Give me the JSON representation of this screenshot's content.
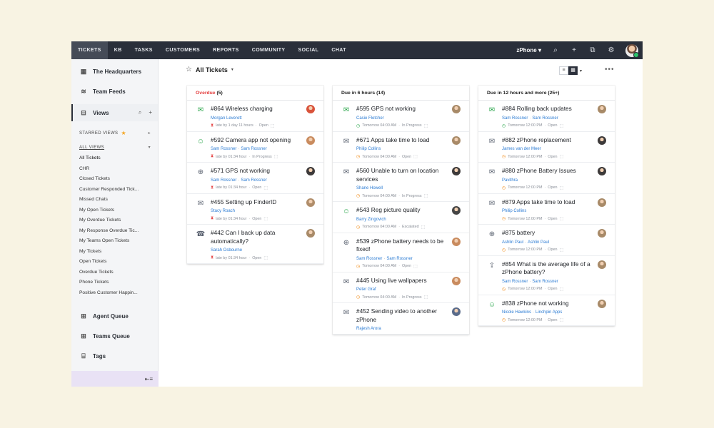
{
  "topbar": {
    "tabs": [
      "TICKETS",
      "KB",
      "TASKS",
      "CUSTOMERS",
      "REPORTS",
      "COMMUNITY",
      "SOCIAL",
      "CHAT"
    ],
    "active_tab": "TICKETS",
    "brand": "zPhone ▾",
    "icons": [
      "search-icon",
      "plus-icon",
      "external-link-icon",
      "gear-icon"
    ]
  },
  "sidebar": {
    "main_items": [
      {
        "label": "The Headquarters",
        "icon": "grid-icon",
        "glyph": "▦"
      },
      {
        "label": "Team Feeds",
        "icon": "feed-icon",
        "glyph": "≋"
      }
    ],
    "views": {
      "label": "Views",
      "glyph": "⊟"
    },
    "starred_label": "STARRED VIEWS",
    "all_views_label": "ALL VIEWS",
    "view_items": [
      "All Tickets",
      "CHR",
      "Closed Tickets",
      "Customer Responded Tick...",
      "Missed Chats",
      "My Open Tickets",
      "My Overdue Tickets",
      "My Response Overdue Tic...",
      "My Teams Open Tickets",
      "My Tickets",
      "Open Tickets",
      "Overdue Tickets",
      "Phone Tickets",
      "Positive Customer Happin...",
      "Response Overdue Tickets"
    ],
    "bottom_items": [
      {
        "label": "Agent Queue",
        "glyph": "⊞"
      },
      {
        "label": "Teams Queue",
        "glyph": "⊞"
      },
      {
        "label": "Tags",
        "glyph": "⌸"
      }
    ],
    "collapse_glyph": "⇤≡"
  },
  "main": {
    "title": "All Tickets",
    "more": "•••"
  },
  "columns": [
    {
      "title": "Overdue",
      "count": "(5)",
      "overdue": true,
      "cards": [
        {
          "id": "#864",
          "subject": "#864 Wireless charging",
          "contacts": [
            "Morgan Leverett"
          ],
          "channel": "email-in",
          "time": "late by 1 day 11 hours",
          "status": "Open",
          "clock": "late",
          "avatar": "#d9533b"
        },
        {
          "id": "#592",
          "subject": "#592 Camera app not opening",
          "contacts": [
            "Sam Rossner",
            "Sam Rossner"
          ],
          "channel": "chat",
          "time": "late by 01:34 hour",
          "status": "In Progress",
          "clock": "late",
          "avatar": "#c98b5e"
        },
        {
          "id": "#571",
          "subject": "#571 GPS not working",
          "contacts": [
            "Sam Rossner",
            "Sam Rossner"
          ],
          "channel": "web",
          "time": "late by 01:34 hour",
          "status": "Open",
          "clock": "late",
          "avatar": "#3d3a3a"
        },
        {
          "id": "#455",
          "subject": "#455 Setting up FinderID",
          "contacts": [
            "Stacy Roach"
          ],
          "channel": "email",
          "time": "late by 01:34 hour",
          "status": "Open",
          "clock": "late",
          "avatar": "#b08d6a"
        },
        {
          "id": "#442",
          "subject": "#442 Can I back up data automatically?",
          "contacts": [
            "Sarah Osbourne"
          ],
          "channel": "phone",
          "time": "late by 01:34 hour",
          "status": "Open",
          "clock": "late",
          "avatar": "#a88a68"
        }
      ]
    },
    {
      "title": "Due in 6 hours",
      "count": "(14)",
      "overdue": false,
      "cards": [
        {
          "id": "#595",
          "subject": "#595 GPS not working",
          "contacts": [
            "Casie Fletcher"
          ],
          "channel": "email-in",
          "time": "Tomorrow 04:00 AM",
          "status": "In Progress",
          "clock": "ok",
          "avatar": "#a88a68"
        },
        {
          "id": "#671",
          "subject": "#671 Apps take time to load",
          "contacts": [
            "Philip Collins"
          ],
          "channel": "email",
          "time": "Tomorrow 04:00 AM",
          "status": "Open",
          "clock": "warn",
          "avatar": "#a88a68"
        },
        {
          "id": "#560",
          "subject": "#560 Unable to turn on location services",
          "contacts": [
            "Shane Howell"
          ],
          "channel": "email-open",
          "time": "Tomorrow 04:00 AM",
          "status": "In Progress",
          "clock": "warn",
          "avatar": "#3d3a3a"
        },
        {
          "id": "#543",
          "subject": "#543 Reg picture quality",
          "contacts": [
            "Barry Zingovich"
          ],
          "channel": "chat",
          "time": "Tomorrow 04:00 AM",
          "status": "Escalated",
          "clock": "warn",
          "avatar": "#454545"
        },
        {
          "id": "#539",
          "subject": "#539 zPhone battery needs to be fixed!",
          "contacts": [
            "Sam Rossner",
            "Sam Rossner"
          ],
          "channel": "web",
          "time": "Tomorrow 04:00 AM",
          "status": "Open",
          "clock": "warn",
          "avatar": "#c98b5e"
        },
        {
          "id": "#445",
          "subject": "#445 Using live wallpapers",
          "contacts": [
            "Peter Graf"
          ],
          "channel": "email-open",
          "time": "Tomorrow 04:00 AM",
          "status": "In Progress",
          "clock": "warn",
          "avatar": "#c98b5e"
        },
        {
          "id": "#452",
          "subject": "#452 Sending video to another zPhone",
          "contacts": [
            "Rajesh Arora"
          ],
          "channel": "email-open",
          "time": "",
          "status": "",
          "clock": "warn",
          "avatar": "#5a6b8a"
        }
      ]
    },
    {
      "title": "Due in 12 hours and more",
      "count": "(25+)",
      "overdue": false,
      "cards": [
        {
          "id": "#884",
          "subject": "#884 Rolling back updates",
          "contacts": [
            "Sam Rossner",
            "Sam Rossner"
          ],
          "channel": "email-in",
          "time": "Tomorrow 12:00 PM",
          "status": "Open",
          "clock": "ok",
          "avatar": "#a88a68"
        },
        {
          "id": "#882",
          "subject": "#882 zPhone replacement",
          "contacts": [
            "James van der Meer"
          ],
          "channel": "email-open",
          "time": "Tomorrow 12:00 PM",
          "status": "Open",
          "clock": "warn",
          "avatar": "#3d3a3a"
        },
        {
          "id": "#880",
          "subject": "#880 zPhone Battery Issues",
          "contacts": [
            "Pavithra"
          ],
          "channel": "email",
          "time": "Tomorrow 12:00 PM",
          "status": "Open",
          "clock": "warn",
          "avatar": "#3d3a3a"
        },
        {
          "id": "#879",
          "subject": "#879 Apps take time to load",
          "contacts": [
            "Philip Collins"
          ],
          "channel": "email",
          "time": "Tomorrow 12:00 PM",
          "status": "Open",
          "clock": "warn",
          "avatar": "#a88a68"
        },
        {
          "id": "#875",
          "subject": "#875 battery",
          "contacts": [
            "Ashlin Paul",
            "Ashlin Paul"
          ],
          "channel": "web",
          "time": "Tomorrow 12:00 PM",
          "status": "Open",
          "clock": "warn",
          "avatar": "#a88a68"
        },
        {
          "id": "#854",
          "subject": "#854 What is the average life of a zPhone battery?",
          "contacts": [
            "Sam Rossner",
            "Sam Rossner"
          ],
          "channel": "email-up",
          "time": "Tomorrow 12:00 PM",
          "status": "Open",
          "clock": "warn",
          "avatar": "#a88a68"
        },
        {
          "id": "#838",
          "subject": "#838 zPhone not working",
          "contacts": [
            "Nicole Hawkins",
            "Linchpin Apps"
          ],
          "channel": "chat",
          "time": "Tomorrow 12:00 PM",
          "status": "Open",
          "clock": "warn",
          "avatar": "#a88a68"
        }
      ]
    }
  ]
}
